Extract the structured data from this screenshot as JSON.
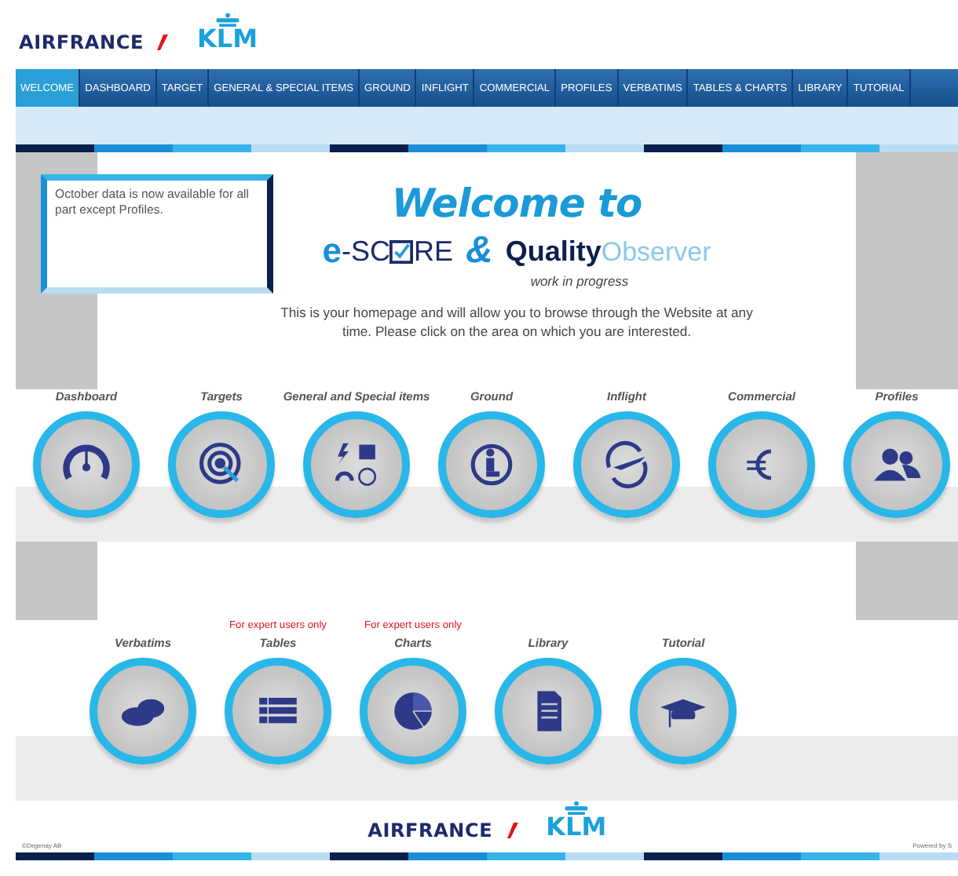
{
  "header": {
    "brand_left": "AIRFRANCE",
    "brand_right": "KLM"
  },
  "nav": [
    {
      "label": "WELCOME",
      "selected": true
    },
    {
      "label": "DASHBOARD",
      "selected": false
    },
    {
      "label": "TARGET",
      "selected": false
    },
    {
      "label": "GENERAL & SPECIAL ITEMS",
      "selected": false
    },
    {
      "label": "GROUND",
      "selected": false
    },
    {
      "label": "INFLIGHT",
      "selected": false
    },
    {
      "label": "COMMERCIAL",
      "selected": false
    },
    {
      "label": "PROFILES",
      "selected": false
    },
    {
      "label": "VERBATIMS",
      "selected": false
    },
    {
      "label": "TABLES & CHARTS",
      "selected": false
    },
    {
      "label": "LIBRARY",
      "selected": false
    },
    {
      "label": "TUTORIAL",
      "selected": false
    }
  ],
  "notice": "October data is now available for all part except Profiles.",
  "welcome": {
    "title": "Welcome to",
    "escore_prefix": "e",
    "escore_middle": "-SC",
    "escore_suffix": "RE",
    "ampersand": "&",
    "quality": "Quality",
    "observer": "Observer",
    "tagline": "work in progress",
    "intro": "This is your homepage and will allow you to browse through the Website at any time. Please click on the area on which you are interested."
  },
  "sections_row_1": [
    {
      "label": "Dashboard"
    },
    {
      "label": "Targets"
    },
    {
      "label": "General and Special items"
    },
    {
      "label": "Ground"
    },
    {
      "label": "Inflight"
    },
    {
      "label": "Commercial"
    },
    {
      "label": "Profiles"
    }
  ],
  "sections_row_2": [
    {
      "label": "Verbatims"
    },
    {
      "label": "Tables",
      "note": "For expert users only"
    },
    {
      "label": "Charts",
      "note": "For expert users only"
    },
    {
      "label": "Library"
    },
    {
      "label": "Tutorial"
    }
  ],
  "footer": {
    "brand_left": "AIRFRANCE",
    "brand_right": "KLM",
    "copyright": "©Degenay AB",
    "powered": "Powered by S"
  }
}
